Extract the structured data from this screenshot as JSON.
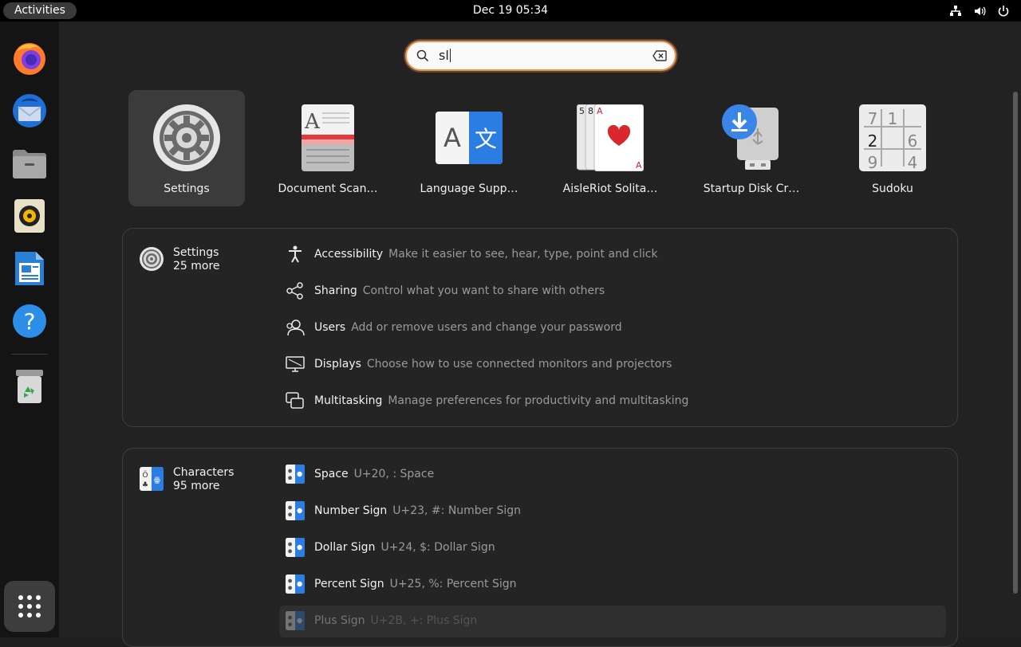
{
  "topbar": {
    "activities": "Activities",
    "clock": "Dec 19  05:34",
    "tray_icons": [
      "network-icon",
      "volume-icon",
      "power-icon"
    ]
  },
  "dock": {
    "items": [
      {
        "name": "firefox"
      },
      {
        "name": "thunderbird"
      },
      {
        "name": "files"
      },
      {
        "name": "rhythmbox"
      },
      {
        "name": "libreoffice-writer"
      },
      {
        "name": "help"
      },
      {
        "name": "trash"
      }
    ]
  },
  "search": {
    "value": "sl"
  },
  "apps": [
    {
      "label": "Settings",
      "selected": true
    },
    {
      "label": "Document Scan…"
    },
    {
      "label": "Language Supp…"
    },
    {
      "label": "AisleRiot Solita…"
    },
    {
      "label": "Startup Disk Cr…"
    },
    {
      "label": "Sudoku"
    }
  ],
  "settings_section": {
    "provider": "Settings",
    "more": "25 more",
    "rows": [
      {
        "title": "Accessibility",
        "desc": "Make it easier to see, hear, type, point and click",
        "icon": "accessibility-icon"
      },
      {
        "title": "Sharing",
        "desc": "Control what you want to share with others",
        "icon": "share-icon"
      },
      {
        "title": "Users",
        "desc": "Add or remove users and change your password",
        "icon": "users-icon"
      },
      {
        "title": "Displays",
        "desc": "Choose how to use connected monitors and projectors",
        "icon": "display-icon"
      },
      {
        "title": "Multitasking",
        "desc": "Manage preferences for productivity and multitasking",
        "icon": "multitasking-icon"
      }
    ]
  },
  "characters_section": {
    "provider": "Characters",
    "more": "95 more",
    "rows": [
      {
        "title": "Space",
        "desc": "U+20,  : Space"
      },
      {
        "title": "Number Sign",
        "desc": "U+23, #: Number Sign"
      },
      {
        "title": "Dollar Sign",
        "desc": "U+24, $: Dollar Sign"
      },
      {
        "title": "Percent Sign",
        "desc": "U+25, %: Percent Sign"
      },
      {
        "title": "Plus Sign",
        "desc": "U+2B, +: Plus Sign"
      }
    ]
  },
  "colors": {
    "accent": "#e8934f",
    "panel": "#242424",
    "background": "#222222"
  }
}
